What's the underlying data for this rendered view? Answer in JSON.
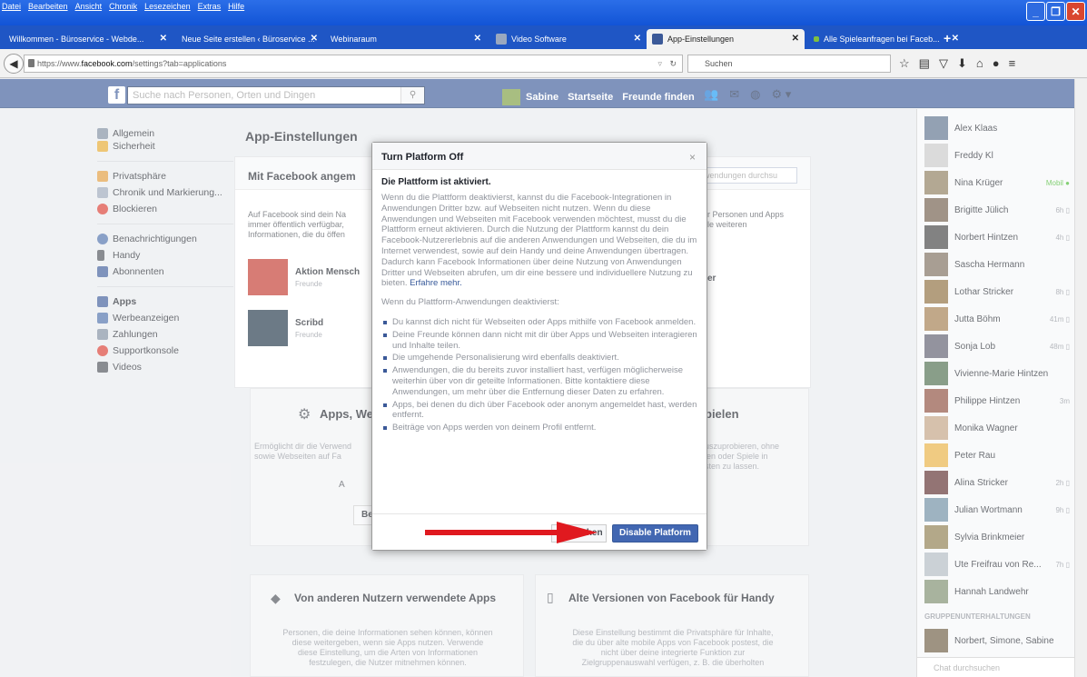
{
  "browser": {
    "menu": [
      "Datei",
      "Bearbeiten",
      "Ansicht",
      "Chronik",
      "Lesezeichen",
      "Extras",
      "Hilfe"
    ],
    "tabs": [
      {
        "title": "Willkommen - Büroservice - Webde..."
      },
      {
        "title": "Neue Seite erstellen ‹ Büroservice ..."
      },
      {
        "title": "Webinaraum"
      },
      {
        "title": "Video Software"
      },
      {
        "title": "App-Einstellungen"
      },
      {
        "title": "Alle Spieleanfragen bei Faceb..."
      }
    ],
    "url_prefix": "https://www.",
    "url_domain": "facebook.com",
    "url_path": "/settings?tab=applications",
    "search_placeholder": "Suchen"
  },
  "fb": {
    "search_placeholder": "Suche nach Personen, Orten und Dingen",
    "user": "Sabine",
    "home": "Startseite",
    "find_friends": "Freunde finden"
  },
  "leftnav": {
    "group1": [
      "Allgemein",
      "Sicherheit"
    ],
    "group2": [
      "Privatsphäre",
      "Chronik und Markierung...",
      "Blockieren"
    ],
    "group3": [
      "Benachrichtigungen",
      "Handy",
      "Abonnenten"
    ],
    "group4": [
      "Apps",
      "Werbeanzeigen",
      "Zahlungen",
      "Supportkonsole",
      "Videos"
    ]
  },
  "main": {
    "title": "App-Einstellungen",
    "card_header": "Mit Facebook angem",
    "app_search": "wendungen durchsu",
    "desc_left": [
      "Auf Facebook sind dein Na",
      "immer öffentlich verfügbar,",
      "Informationen, die du öffen"
    ],
    "desc_right": [
      "r Personen und Apps",
      "le weiteren"
    ],
    "apps": [
      {
        "name": "Aktion Mensch",
        "sub": "Freunde"
      },
      {
        "name": "Scribd",
        "sub": "Freunde"
      }
    ],
    "app_right": "er",
    "cards": [
      {
        "title": "Apps, Web",
        "title_right": "pielen",
        "desc": [
          "Ermöglicht dir die Verwend",
          "sowie Webseiten auf Fa"
        ],
        "desc_right": [
          "uszuprobieren, ohne",
          "ien oder Spiele in",
          "sten zu lassen."
        ],
        "btn_letter": "A",
        "btn": "Be"
      },
      {
        "title": "Von anderen Nutzern verwendete Apps",
        "desc": [
          "Personen, die deine Informationen sehen können, können",
          "diese weitergeben, wenn sie Apps nutzen. Verwende",
          "diese Einstellung, um die Arten von Informationen",
          "festzulegen, die Nutzer mitnehmen können."
        ]
      },
      {
        "title": "Alte Versionen von Facebook für Handy",
        "desc": [
          "Diese Einstellung bestimmt die Privatsphäre für Inhalte,",
          "die du über alte mobile Apps von Facebook postest, die",
          "nicht über deine integrierte Funktion zur",
          "Zielgruppenauswahl verfügen, z. B. die überholten"
        ]
      }
    ]
  },
  "modal": {
    "title": "Turn Platform Off",
    "close": "×",
    "heading": "Die Plattform ist aktiviert.",
    "para1": "Wenn du die Plattform deaktivierst, kannst du die Facebook-Integrationen in Anwendungen Dritter bzw. auf Webseiten nicht nutzen. Wenn du diese Anwendungen und Webseiten mit Facebook verwenden möchtest, musst du die Plattform erneut aktivieren. Durch die Nutzung der Plattform kannst du dein Facebook-Nutzererlebnis auf die anderen Anwendungen und Webseiten, die du im Internet verwendest, sowie auf dein Handy und deine Anwendungen übertragen. Dadurch kann Facebook Informationen über deine Nutzung von Anwendungen Dritter und Webseiten abrufen, um dir eine bessere und individuellere Nutzung zu bieten.",
    "link": "Erfahre mehr.",
    "para2": "Wenn du Plattform-Anwendungen deaktivierst:",
    "bullets": [
      "Du kannst dich nicht für Webseiten oder Apps mithilfe von Facebook anmelden.",
      "Deine Freunde können dann nicht mit dir über Apps und Webseiten interagieren und Inhalte teilen.",
      "Die umgehende Personalisierung wird ebenfalls deaktiviert.",
      "Anwendungen, die du bereits zuvor installiert hast, verfügen möglicherweise weiterhin über von dir geteilte Informationen. Bitte kontaktiere diese Anwendungen, um mehr über die Entfernung dieser Daten zu erfahren.",
      "Apps, bei denen du dich über Facebook oder anonym angemeldet hast, werden entfernt.",
      "Beiträge von Apps werden von deinem Profil entfernt."
    ],
    "cancel": "Abbrechen",
    "disable": "Disable Platform"
  },
  "chat": {
    "contacts": [
      {
        "name": "Alex Klaas",
        "status": ""
      },
      {
        "name": "Freddy Kl",
        "status": ""
      },
      {
        "name": "Nina Krüger",
        "status": "Mobil ●"
      },
      {
        "name": "Brigitte Jülich",
        "status": "6h ▯"
      },
      {
        "name": "Norbert Hintzen",
        "status": "4h ▯"
      },
      {
        "name": "Sascha Hermann",
        "status": ""
      },
      {
        "name": "Lothar Stricker",
        "status": "8h ▯"
      },
      {
        "name": "Jutta Böhm",
        "status": "41m ▯"
      },
      {
        "name": "Sonja Lob",
        "status": "48m ▯"
      },
      {
        "name": "Vivienne-Marie Hintzen",
        "status": ""
      },
      {
        "name": "Philippe Hintzen",
        "status": "3m"
      },
      {
        "name": "Monika Wagner",
        "status": ""
      },
      {
        "name": "Peter Rau",
        "status": ""
      },
      {
        "name": "Alina Stricker",
        "status": "2h ▯"
      },
      {
        "name": "Julian Wortmann",
        "status": "9h ▯"
      },
      {
        "name": "Sylvia Brinkmeier",
        "status": ""
      },
      {
        "name": "Ute Freifrau von Re...",
        "status": "7h ▯"
      },
      {
        "name": "Hannah Landwehr",
        "status": ""
      }
    ],
    "group_title": "GRUPPENUNTERHALTUNGEN",
    "group": "Norbert, Simone, Sabine",
    "search": "Chat durchsuchen"
  }
}
